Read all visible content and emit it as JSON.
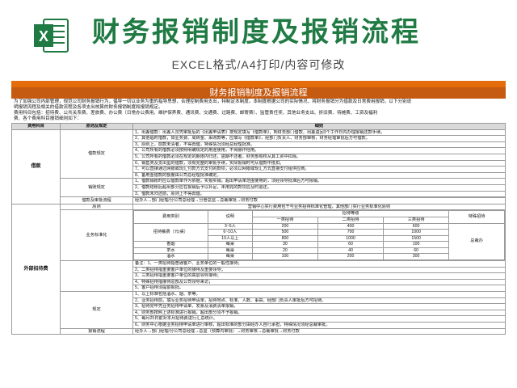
{
  "hero": {
    "title": "财务报销制度及报销流程",
    "subtitle": "EXCEL格式/A4打印/内容可修改",
    "logo_letter": "X",
    "brand_color": "#1f7a43",
    "accent_color": "#e46c0a"
  },
  "doc": {
    "title": "财务报销制度及报销流程",
    "intro_lines": [
      "为了加强公司内部管理，规范公司财务报销行为，倡导一切以业务为重的指导思想，合理控制费用支出，特制定本制度。本制度根据公司的实际情况，将财务报销分为借款及日常费用报销，以下分别说",
      "明报销流程及相关的借款流程及各项支出核算的财务报销制度和报销规定。",
      "费用科目包括：招待费、公共关系费、差旅费、办公费（日常办公费用、维护保养费、通讯费、交通费、过路费、邮寄费）、监管责任奖、其他业务支出、折旧费、待摊费、工资及福利",
      "费、各个费用科目报销细则如下："
    ],
    "headers": {
      "h1": "费用科目",
      "h2": "原则及规定",
      "h3": "细则"
    },
    "loan": {
      "category": "借款",
      "sub_regulation": "借款规定",
      "sub_repay": "销账规定",
      "sub_approval": "借款及审批流程",
      "regulation_rules": [
        "1、出差借款：出差人员凭审批后的《出差申请表》按规定填写《借款单》，到财务部门借款，出差返回3个工作日内办理报销还款手续。",
        "2、其他临时借款，如业务费、周转金、采购款等，应填写《借款单》，经部门负责人、财务部审核，财务经理审批后方可借款。",
        "3、原则上，前款未清者，不得再借，特殊情况须经总经理批准。",
        "4、公司所有的借款必须按照明确规定的用途使用，不得挪作他用。",
        "5、公司所有的借款必须在规定的期限内归还，逾期不还者，财务部有权从其工资中扣除。",
        "6、销售类及支出型的借款，须有完整的审批手续，实际报销时可从借款中抵扣。",
        "7、可以直接通过网银或现汇付款方式支付的款项，必须以网银或现汇方式直接支付给供应商。",
        "8、备用金借款的额度由公司总经理批准确定。"
      ],
      "repay_rules": [
        "1、借款销账时应以借款单作为依据，实报实销，超出申请单范围使用的，须经领导批准后方可报销。",
        "2、借款结账后超出部分应在报销后予以补足，未用完的款项应及时退还。",
        "3、借款未归还前，原则上不得再借。"
      ],
      "approval_text": "经办人→部门经理/分公司总经理→分管总监→总裁审批→财务付款"
    },
    "ent": {
      "category": "外部招待费",
      "principle_label": "原则",
      "principle_text": "营销中心实行费用包干与业务招待标准化管理，其他部门实行业务标准化原则",
      "sub_standard": "业务标准化",
      "th_type": "费用类别",
      "th_desc": "说明",
      "th_grade": "招待等级",
      "th_g1": "一类招待",
      "th_g2": "二类招待",
      "th_g3": "三类招待",
      "th_special": "特殊招待",
      "row_meal": "招待餐费（元/桌）",
      "ranges": [
        "3~5人",
        "6~10人",
        "10人以上"
      ],
      "meal_values": [
        [
          "200",
          "400",
          "600"
        ],
        [
          "500",
          "700",
          "1000"
        ],
        [
          "800",
          "1000",
          "1500"
        ]
      ],
      "special_value": "总裁办",
      "items": [
        {
          "name": "香烟",
          "unit": "每桌",
          "values": [
            "30",
            "60",
            "100"
          ]
        },
        {
          "name": "茶水",
          "unit": "每桌",
          "values": [
            "20",
            "40",
            "60"
          ]
        },
        {
          "name": "酒水",
          "unit": "每桌",
          "values": [
            "100",
            "200",
            "300"
          ]
        }
      ],
      "notes": [
        "备注：1、一类招待指普通客户、业务单位的一般性接待；",
        "2、二类招待指重要客户单位的接待及重要领导；",
        "3、三类招待指重要客户单位的高层领导接待；",
        "4、特殊招待指接待总部及公司领导来访；",
        "5、客户招待须提前报批。"
      ],
      "sub_rules": "规定",
      "rules": [
        "1、以上标准包括酒水、烟、茶等。",
        "2、业务招待前，填写业务招待申请单，招待地点、标准、人数、事由，经部门负责人审批后方可招待。",
        "3、招待完毕凭业务招待申请单、发票及消费清单报销。",
        "4、财务部按照上述标准进行报销，超出部分须不予报销。",
        "5、每月25日前对本月招待费进行汇总统计。",
        "6、财务中心根据业务招待申请单进行审核，超出标准的部分由经办人自行承担，特殊情况须经总裁审批。"
      ],
      "sub_process": "报销流程",
      "process_text": "经办人→部门经理/分公司总经理→总监（预算内审批）→财务审核→总裁审批→财务付款"
    }
  }
}
